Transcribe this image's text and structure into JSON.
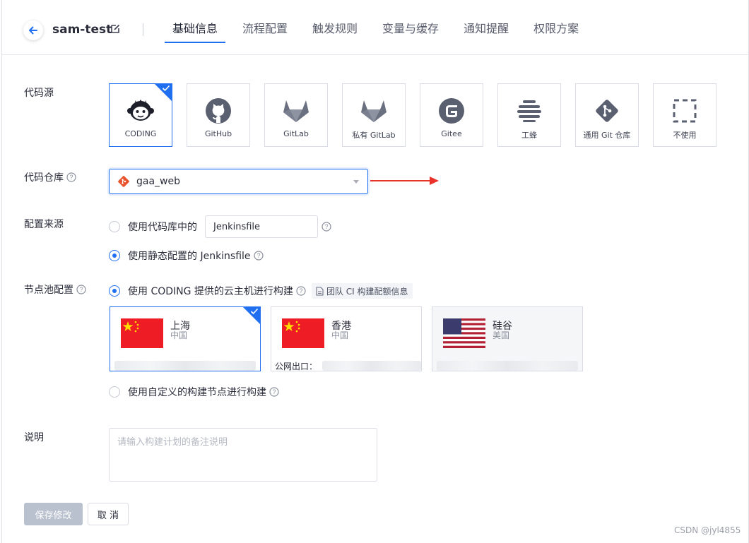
{
  "header": {
    "project_name": "sam-test",
    "tabs": [
      {
        "label": "基础信息",
        "active": true
      },
      {
        "label": "流程配置",
        "active": false
      },
      {
        "label": "触发规则",
        "active": false
      },
      {
        "label": "变量与缓存",
        "active": false
      },
      {
        "label": "通知提醒",
        "active": false
      },
      {
        "label": "权限方案",
        "active": false
      }
    ]
  },
  "form": {
    "code_source": {
      "label": "代码源",
      "options": [
        {
          "name": "CODING",
          "icon": "coding-icon",
          "selected": true
        },
        {
          "name": "GitHub",
          "icon": "github-icon",
          "selected": false
        },
        {
          "name": "GitLab",
          "icon": "gitlab-icon",
          "selected": false
        },
        {
          "name": "私有 GitLab",
          "icon": "gitlab-icon",
          "selected": false
        },
        {
          "name": "Gitee",
          "icon": "gitee-icon",
          "selected": false
        },
        {
          "name": "工蜂",
          "icon": "gongfeng-icon",
          "selected": false
        },
        {
          "name": "通用 Git 仓库",
          "icon": "git-icon",
          "selected": false
        },
        {
          "name": "不使用",
          "icon": "none-icon",
          "selected": false
        }
      ]
    },
    "repo": {
      "label": "代码仓库",
      "value": "gaa_web",
      "icon": "git-icon"
    },
    "config_source": {
      "label": "配置来源",
      "option1_label": "使用代码库中的",
      "option1_input": "Jenkinsfile",
      "option2_label": "使用静态配置的 Jenkinsfile",
      "selected": 2
    },
    "node_pool": {
      "label": "节点池配置",
      "option1_label": "使用 CODING 提供的云主机进行构建",
      "quota_tag": "团队 CI 构建配额信息",
      "option2_label": "使用自定义的构建节点进行构建",
      "selected": 1,
      "regions": [
        {
          "city": "上海",
          "country": "中国",
          "flag": "cn",
          "ip": "",
          "selected": true
        },
        {
          "city": "香港",
          "country": "中国",
          "flag": "cn",
          "ip": "公网出口：",
          "selected": false
        },
        {
          "city": "硅谷",
          "country": "美国",
          "flag": "us",
          "ip": "",
          "selected": false
        }
      ]
    },
    "description": {
      "label": "说明",
      "placeholder": "请输入构建计划的备注说明"
    }
  },
  "actions": {
    "save": "保存修改",
    "cancel": "取 消"
  },
  "watermark": "CSDN @jyl4855",
  "colors": {
    "accent": "#1f6ff0",
    "annotation_arrow": "#e8322a",
    "disabled_button": "#b9c0ce"
  }
}
